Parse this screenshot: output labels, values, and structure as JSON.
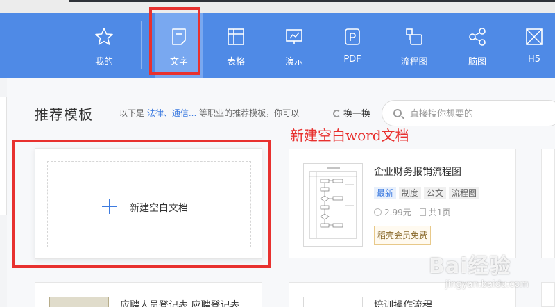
{
  "nav": {
    "items": [
      {
        "label": "我的",
        "icon": "star-icon"
      },
      {
        "label": "文字",
        "icon": "document-icon"
      },
      {
        "label": "表格",
        "icon": "table-icon"
      },
      {
        "label": "演示",
        "icon": "presentation-icon"
      },
      {
        "label": "PDF",
        "icon": "pdf-icon"
      },
      {
        "label": "流程图",
        "icon": "flowchart-icon"
      },
      {
        "label": "脑图",
        "icon": "mindmap-icon"
      },
      {
        "label": "H5",
        "icon": "h5-icon"
      }
    ],
    "active": "文字",
    "color": "#4f8ae6",
    "active_color": "#79a8f0"
  },
  "section": {
    "title": "推荐模板",
    "desc_prefix": "以下是",
    "desc_link": "法律、通信...",
    "desc_suffix": "等职业的推荐模板，你可以",
    "refresh_label": "换一换"
  },
  "search": {
    "placeholder": "直接搜你想要的"
  },
  "annotation": {
    "text": "新建空白word文档",
    "color": "#e8312f"
  },
  "blank_card": {
    "label": "新建空白文档"
  },
  "template_card": {
    "title": "企业财务报销流程图",
    "tags": [
      "最新",
      "制度",
      "公文",
      "流程图"
    ],
    "price": "2.99元",
    "pages": "共1页",
    "vip_label": "稻壳会员免费"
  },
  "bottom_cards": [
    {
      "title": "应聘人员登记表 应聘登记表 ..."
    },
    {
      "title": "培训操作流程"
    }
  ],
  "watermark": {
    "text": "Bai经验",
    "sub": "jingyan.baidu.com"
  }
}
